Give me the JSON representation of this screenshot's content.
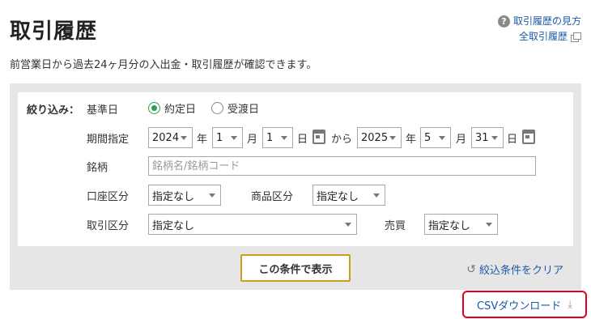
{
  "header": {
    "title": "取引履歴",
    "help_link": "取引履歴の見方",
    "all_history_link": "全取引履歴",
    "description": "前営業日から過去24ヶ月分の入出金・取引履歴が確認できます。"
  },
  "filter": {
    "label": "絞り込み：",
    "base_date": {
      "label": "基準日",
      "options": [
        {
          "label": "約定日",
          "checked": true
        },
        {
          "label": "受渡日",
          "checked": false
        }
      ]
    },
    "period": {
      "label": "期間指定",
      "from": {
        "year": "2024",
        "month": "1",
        "day": "1"
      },
      "to": {
        "year": "2025",
        "month": "5",
        "day": "31"
      },
      "year_unit": "年",
      "month_unit": "月",
      "day_unit": "日",
      "separator": "から"
    },
    "symbol": {
      "label": "銘柄",
      "placeholder": "銘柄名/銘柄コード",
      "value": ""
    },
    "account_type": {
      "label": "口座区分",
      "value": "指定なし"
    },
    "product_type": {
      "label": "商品区分",
      "value": "指定なし"
    },
    "trade_type": {
      "label": "取引区分",
      "value": "指定なし"
    },
    "buy_sell": {
      "label": "売買",
      "value": "指定なし"
    },
    "search_button": "この条件で表示",
    "clear_link": "絞込条件をクリア"
  },
  "csv_download": "CSVダウンロード",
  "colors": {
    "link": "#1a5aa6",
    "panel_bg": "#e6e6e6",
    "radio_checked": "#2e9e4f",
    "search_border": "#c8a020",
    "csv_highlight": "#e3001b"
  }
}
